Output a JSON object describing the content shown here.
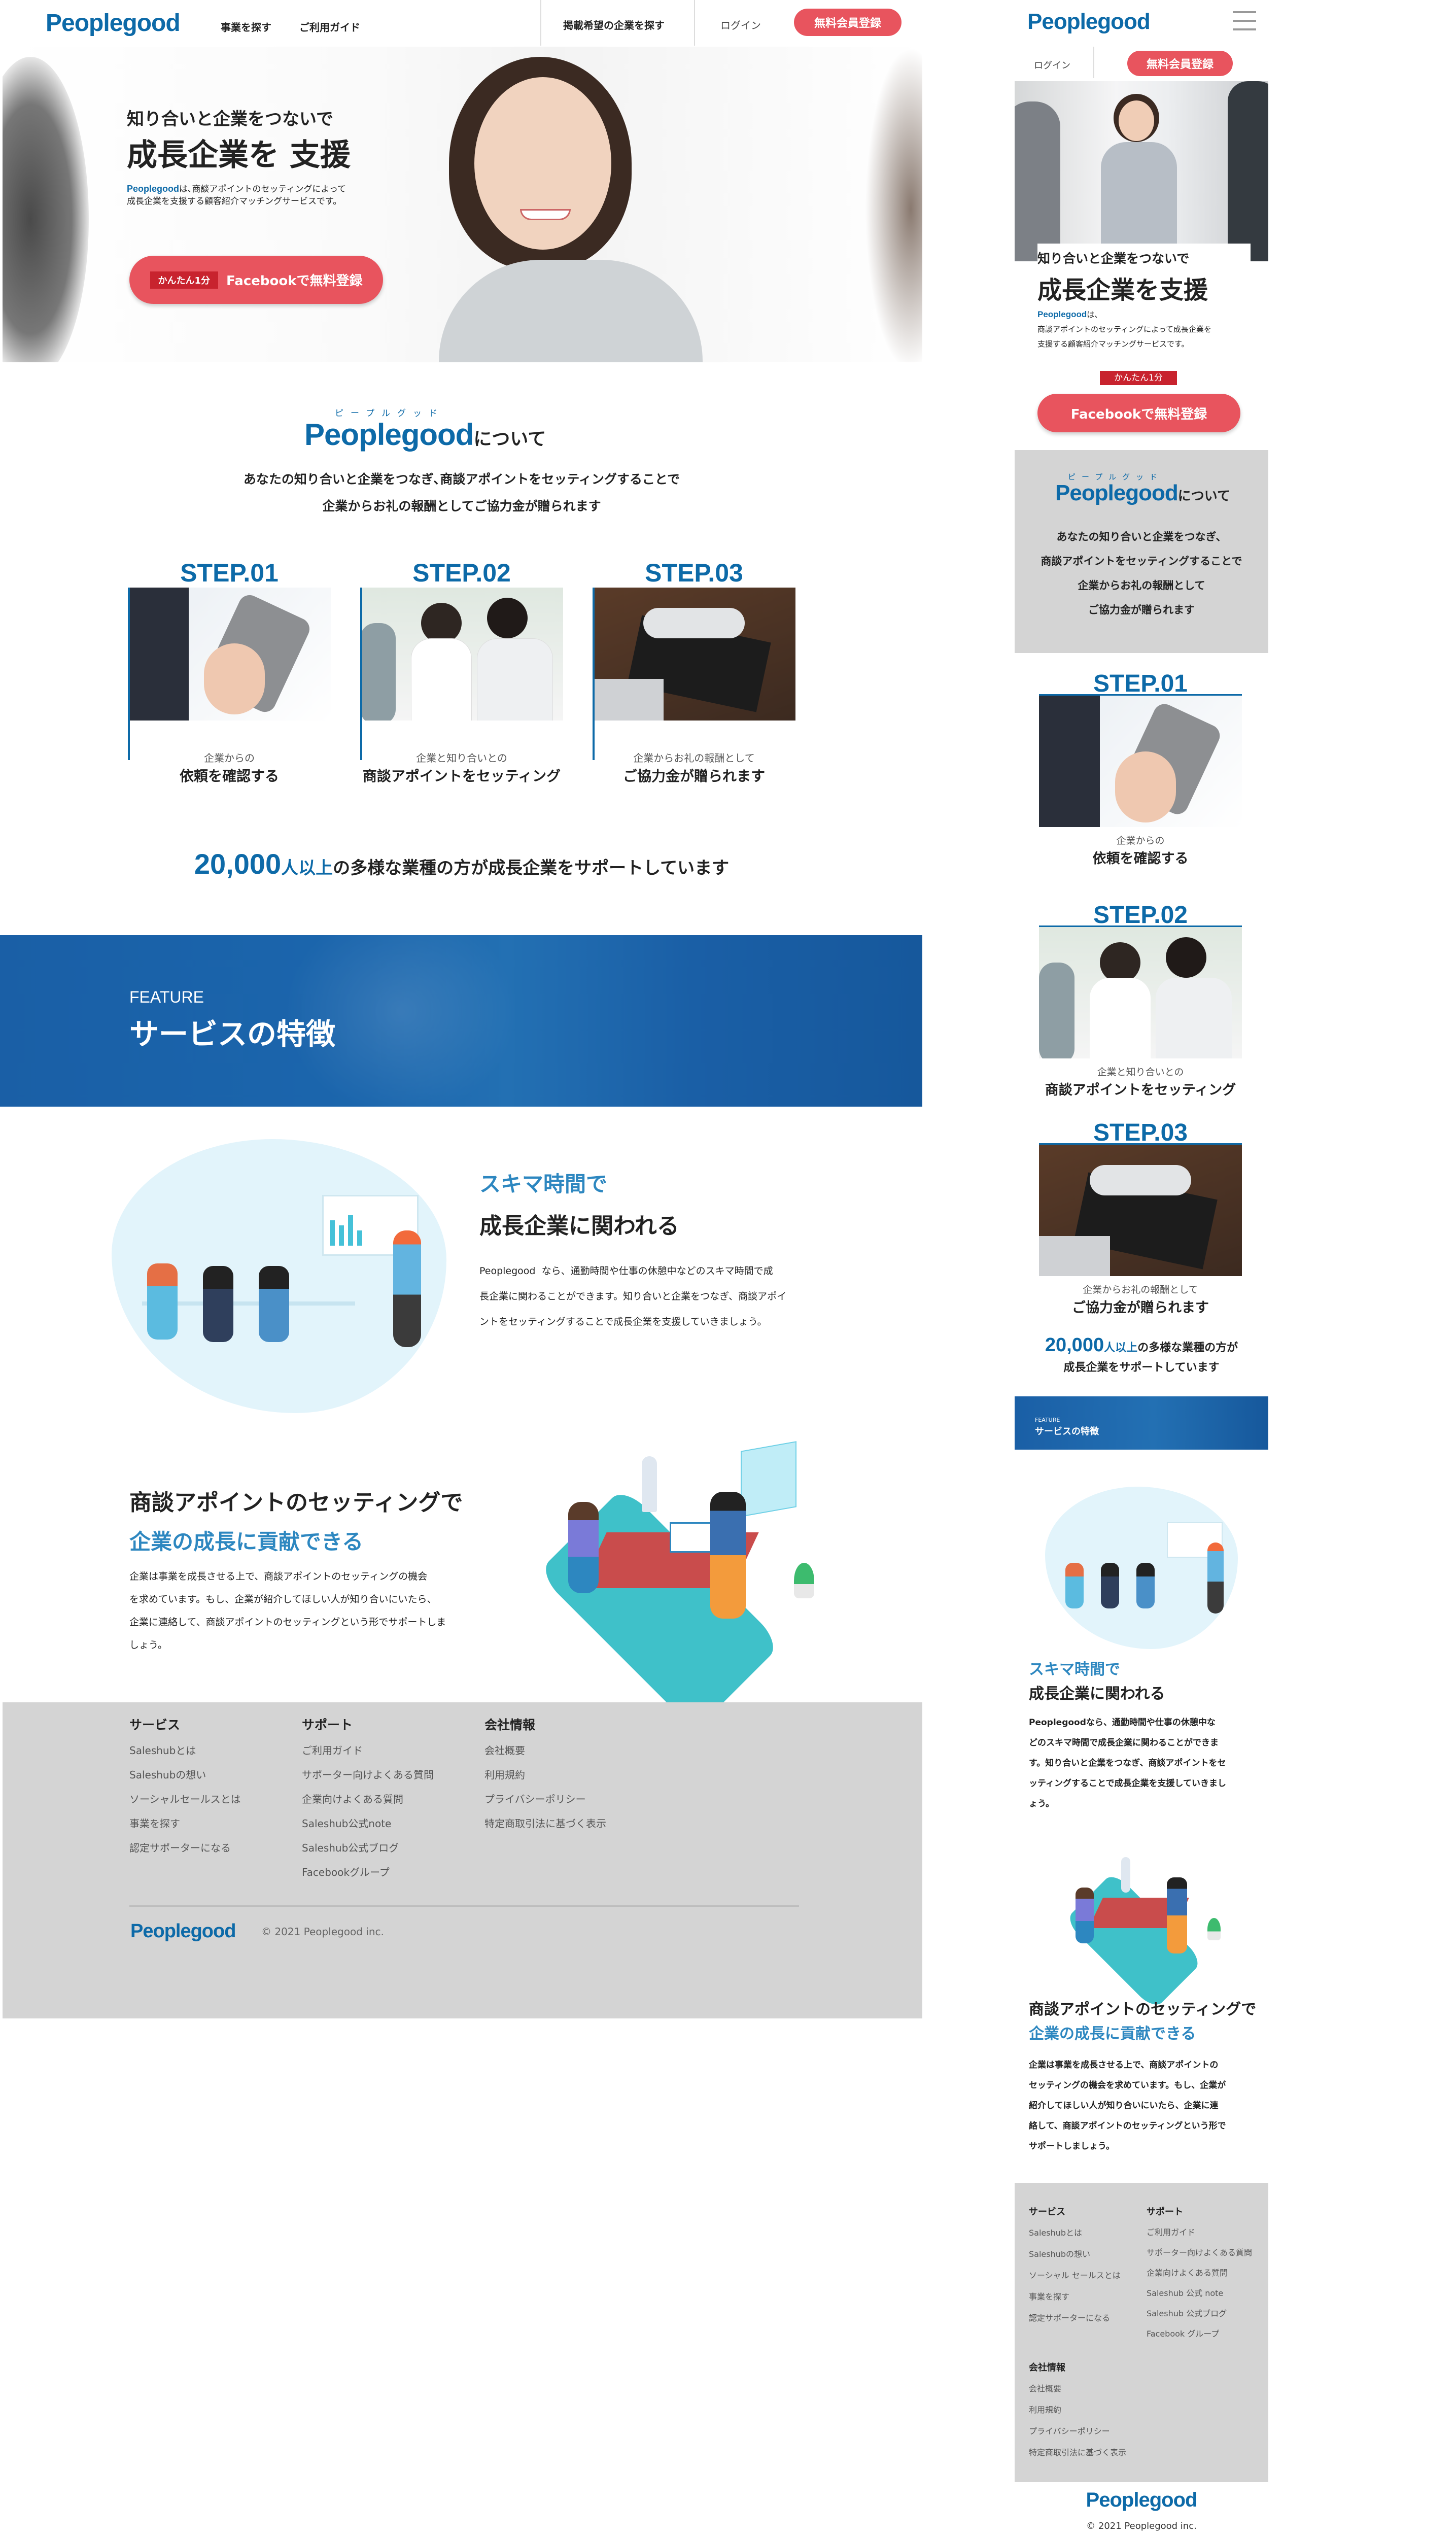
{
  "brand": "Peoplegood",
  "colors": {
    "accent": "#0d6aa8",
    "red": "#e8545e",
    "footer": "#d4d4d4",
    "hero_blue": "#1a67ad"
  },
  "nav": {
    "find": "事業を探す",
    "guide": "ご利用ガイド",
    "post": "掲載希望の企業を探す",
    "login": "ログイン",
    "signup": "無料会員登録"
  },
  "hero": {
    "line1": "知り合いと企業をつないで",
    "line2": "成長企業を 支援",
    "brand": "Peoplegood",
    "desc1": "は､商談アポイントのセッティングによって",
    "desc2": "成長企業を支援する顧客紹介マッチングサービスです。",
    "badge": "かんたん1分",
    "cta": "Facebookで無料登録"
  },
  "about": {
    "ruby": "ピープルグッド",
    "title_suffix": "について",
    "line1": "あなたの知り合いと企業をつなぎ､商談アポイントをセッティングすることで",
    "line2": "企業からお礼の報酬としてご協力金が贈られます"
  },
  "steps": [
    {
      "label": "STEP.01",
      "sub": "企業からの",
      "main": "依頼を確認する"
    },
    {
      "label": "STEP.02",
      "sub": "企業と知り合いとの",
      "main": "商談アポイントをセッティング"
    },
    {
      "label": "STEP.03",
      "sub": "企業からお礼の報酬として",
      "main": "ご協力金が贈られます"
    }
  ],
  "stats": {
    "number": "20,000",
    "unit": "人以上",
    "text": "の多様な業種の方が成長企業をサポートしています",
    "m_text1": "の多様な業種の方が",
    "m_text2": "成長企業をサポートしています"
  },
  "feature": {
    "en": "FEATURE",
    "title": "サービスの特徴"
  },
  "feature1": {
    "h1": "スキマ時間で",
    "h2": "成長企業に関われる",
    "brand": "Peoplegood",
    "body1": "なら、通勤時間や仕事の休憩中などのスキマ時間で成",
    "body2": "長企業に関わることができます。知り合いと企業をつなぎ、商談アポイ",
    "body3": "ントをセッティングすることで成長企業を支援していきましょう。",
    "m_line1": "Peoplegoodなら、通勤時間や仕事の休憩中な",
    "m_line2": "どのスキマ時間で成長企業に関わることができま",
    "m_line3": "す。知り合いと企業をつなぎ、商談アポイントをセ",
    "m_line4": "ッティングすることで成長企業を支援していきまし",
    "m_line5": "ょう。"
  },
  "feature2": {
    "h1": "商談アポイントのセッティングで",
    "h2": "企業の成長に貢献できる",
    "body1": "企業は事業を成長させる上で、商談アポイントのセッティングの機会",
    "body2": "を求めています。もし、企業が紹介してほしい人が知り合いにいたら、",
    "body3": "企業に連絡して、商談アポイントのセッティングという形でサポートしま",
    "body4": "しょう。",
    "m_line1": "企業は事業を成長させる上で、商談アポイントの",
    "m_line2": "セッティングの機会を求めています。もし、企業が",
    "m_line3": "紹介してほしい人が知り合いにいたら、企業に連",
    "m_line4": "絡して、商談アポイントのセッティングという形で",
    "m_line5": "サポートしましょう。"
  },
  "footer": {
    "service": {
      "head": "サービス",
      "links": [
        "Saleshubとは",
        "Saleshubの想い",
        "ソーシャルセールスとは",
        "事業を探す",
        "認定サポーターになる"
      ]
    },
    "support": {
      "head": "サポート",
      "links": [
        "ご利用ガイド",
        "サポーター向けよくある質問",
        "企業向けよくある質問",
        "Saleshub公式note",
        "Saleshub公式ブログ",
        "Facebookグループ"
      ]
    },
    "company": {
      "head": "会社情報",
      "links": [
        "会社概要",
        "利用規約",
        "プライバシーポリシー",
        "特定商取引法に基づく表示"
      ]
    },
    "copyright": "© 2021 Peoplegood inc."
  },
  "mobile": {
    "hero_line1": "知り合いと企業をつないで",
    "hero_line2": "成長企業を支援",
    "hero_brand": "Peoplegood",
    "hero_desc1": "は、",
    "hero_desc2": "商談アポイントのセッティングによって成長企業を",
    "hero_desc3": "支援する顧客紹介マッチングサービスです。",
    "about_line1": "あなたの知り合いと企業をつなぎ、",
    "about_line2": "商談アポイントをセッティングすることで",
    "about_line3": "企業からお礼の報酬として",
    "about_line4": "ご協力金が贈られます",
    "support_links": [
      "ご利用ガイド",
      "サポーター向けよくある質問",
      "企業向けよくある質問",
      "Saleshub 公式 note",
      "Saleshub 公式ブログ",
      "Facebook グループ"
    ],
    "service_links": [
      "Saleshubとは",
      "Saleshubの想い",
      "ソーシャル セールスとは",
      "事業を探す",
      "認定サポーターになる"
    ]
  },
  "icons": {
    "menu": "hamburger-icon"
  }
}
